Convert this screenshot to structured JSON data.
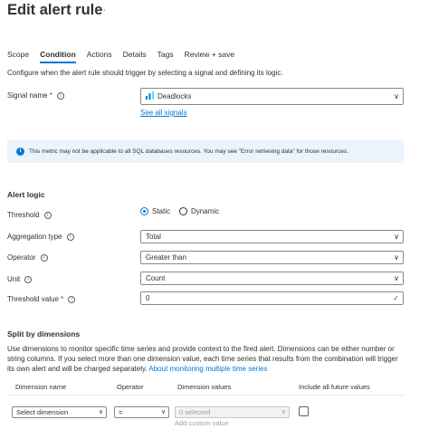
{
  "header": {
    "title": "Edit alert rule",
    "more": "···"
  },
  "tabs": [
    "Scope",
    "Condition",
    "Actions",
    "Details",
    "Tags",
    "Review + save"
  ],
  "intro": "Configure when the alert rule should trigger by selecting a signal and defining its logic.",
  "signal": {
    "label": "Signal name",
    "value": "Deadlocks",
    "see_all": "See all signals"
  },
  "banner": {
    "icon": "info-icon",
    "text": "This metric may not be applicable to all SQL databases resources. You may see \"Error retrieving data\" for those resources."
  },
  "alert_logic": {
    "heading": "Alert logic",
    "threshold_label": "Threshold",
    "threshold_options": [
      "Static",
      "Dynamic"
    ],
    "threshold_selected": "Static",
    "aggregation_label": "Aggregation type",
    "aggregation_value": "Total",
    "operator_label": "Operator",
    "operator_value": "Greater than",
    "unit_label": "Unit",
    "unit_value": "Count",
    "threshold_value_label": "Threshold value",
    "threshold_value": "0"
  },
  "split": {
    "heading": "Split by dimensions",
    "description": "Use dimensions to monitor specific time series and provide context to the fired alert. Dimensions can be either number or string columns. If you select more than one dimension value, each time series that results from the combination will trigger its own alert and will be charged separately.",
    "link": "About monitoring multiple time series",
    "columns": [
      "Dimension name",
      "Operator",
      "Dimension values",
      "Include all future values"
    ],
    "row": {
      "dimension_placeholder": "Select dimension",
      "operator_value": "=",
      "values_placeholder": "0 selected"
    },
    "add_custom_value": "Add custom value"
  },
  "colors": {
    "accent": "#0078d4",
    "banner_bg": "#ebf3fc",
    "required": "#a4262c",
    "valid": "#107c10"
  }
}
